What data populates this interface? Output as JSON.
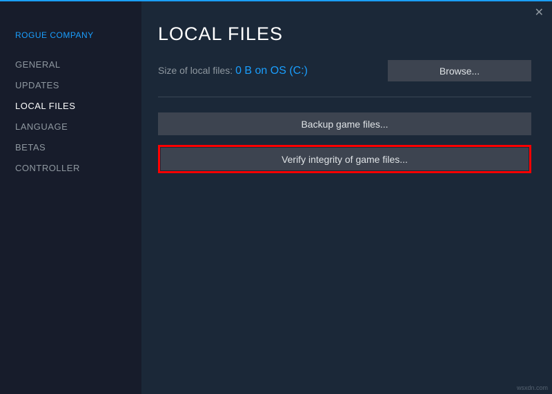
{
  "header": {
    "game_title": "ROGUE COMPANY"
  },
  "sidebar": {
    "items": [
      {
        "label": "GENERAL",
        "active": false
      },
      {
        "label": "UPDATES",
        "active": false
      },
      {
        "label": "LOCAL FILES",
        "active": true
      },
      {
        "label": "LANGUAGE",
        "active": false
      },
      {
        "label": "BETAS",
        "active": false
      },
      {
        "label": "CONTROLLER",
        "active": false
      }
    ]
  },
  "main": {
    "title": "LOCAL FILES",
    "size_label": "Size of local files: ",
    "size_value": "0 B on OS (C:)",
    "browse_label": "Browse...",
    "backup_label": "Backup game files...",
    "verify_label": "Verify integrity of game files..."
  },
  "watermark": "wsxdn.com"
}
